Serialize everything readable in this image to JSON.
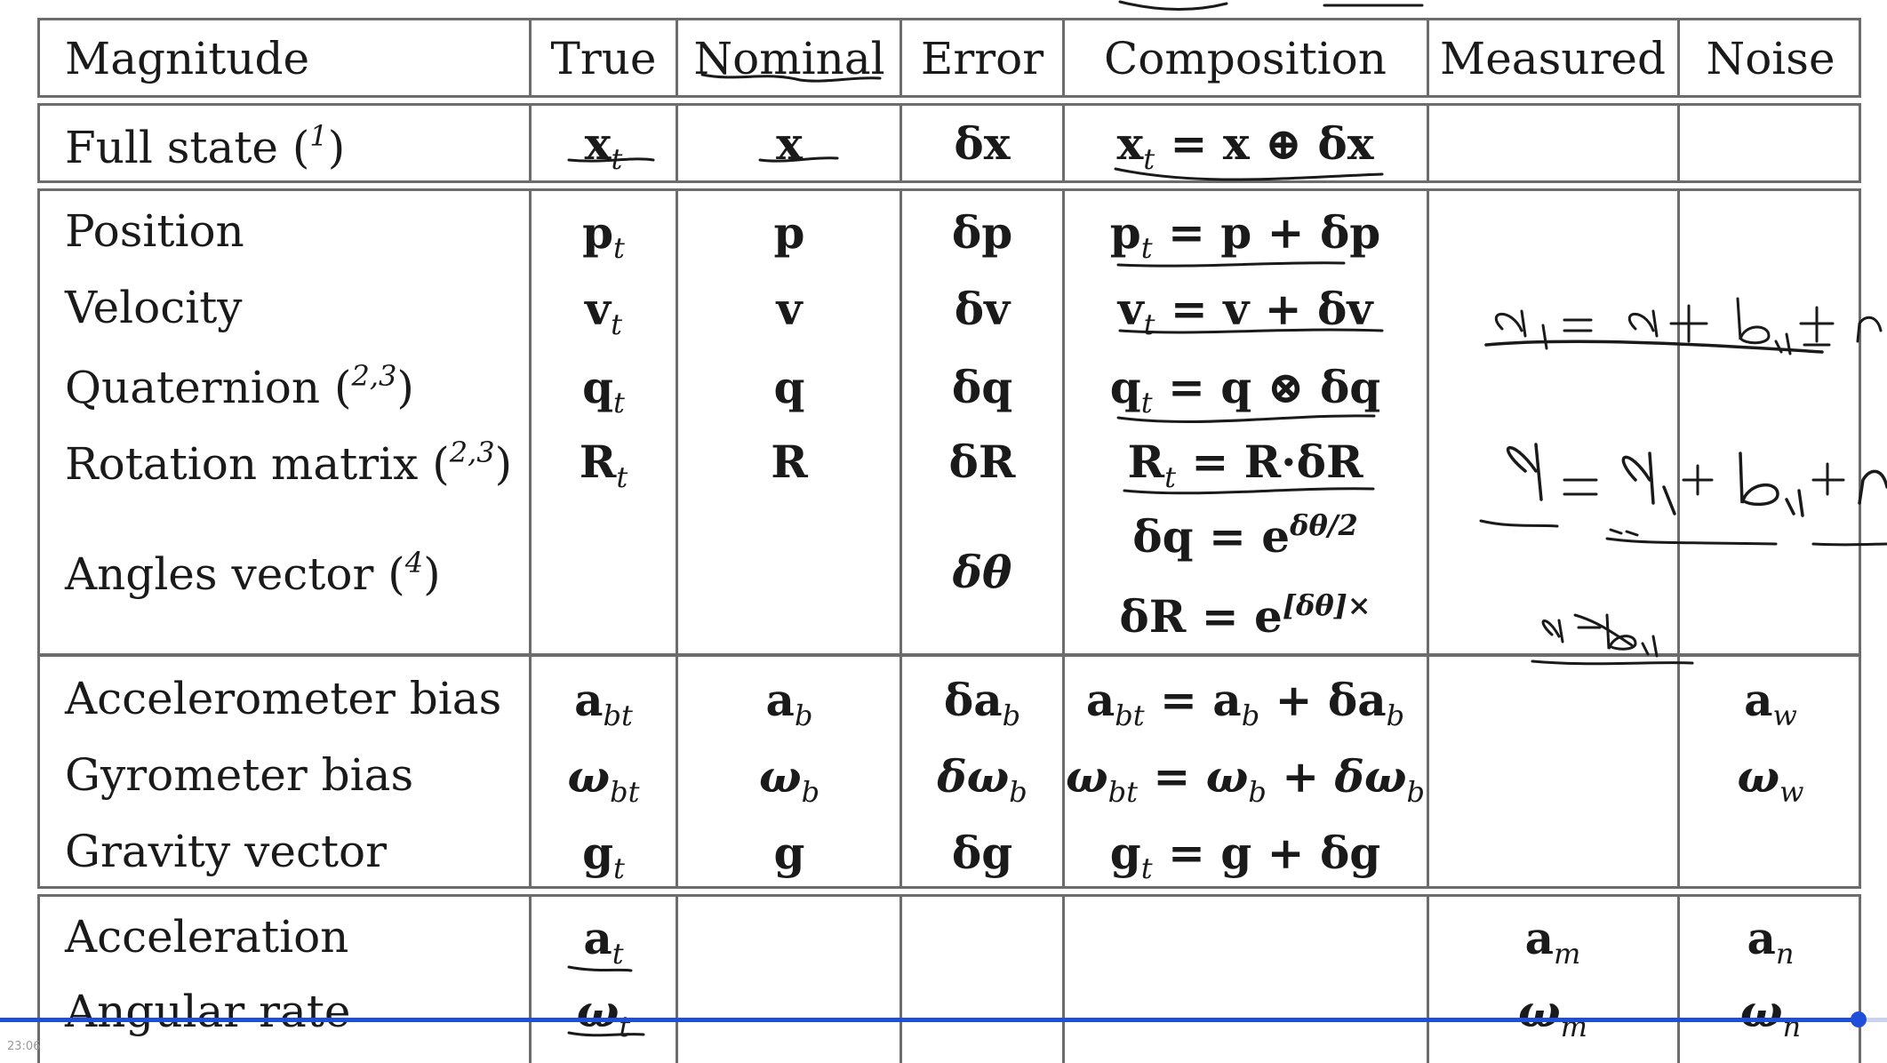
{
  "header": {
    "magnitude": "Magnitude",
    "true": "True",
    "nominal": "Nominal",
    "error": "Error",
    "composition": "Composition",
    "measured": "Measured",
    "noise": "Noise"
  },
  "rows": {
    "full_state": {
      "label": "Full state",
      "sup": "1",
      "true": "x",
      "true_sub": "t",
      "nominal": "x",
      "error": "δx",
      "composition": "x",
      "composition_sub": "t",
      "composition_rhs": " = x ⊕ δx"
    },
    "position": {
      "label": "Position",
      "true": "p",
      "true_sub": "t",
      "nominal": "p",
      "error": "δp",
      "composition": "p",
      "composition_sub": "t",
      "composition_rhs": " = p + δp"
    },
    "velocity": {
      "label": "Velocity",
      "true": "v",
      "true_sub": "t",
      "nominal": "v",
      "error": "δv",
      "composition": "v",
      "composition_sub": "t",
      "composition_rhs": " = v + δv"
    },
    "quaternion": {
      "label": "Quaternion",
      "sup": "2,3",
      "true": "q",
      "true_sub": "t",
      "nominal": "q",
      "error": "δq",
      "composition": "q",
      "composition_sub": "t",
      "composition_rhs": " = q ⊗ δq"
    },
    "rotation": {
      "label": "Rotation matrix",
      "sup": "2,3",
      "true": "R",
      "true_sub": "t",
      "nominal": "R",
      "error": "δR",
      "composition": "R",
      "composition_sub": "t",
      "composition_rhs": " = R·δR"
    },
    "angles": {
      "label": "Angles vector",
      "sup": "4",
      "error": "δθ",
      "composition_1": "δq = e",
      "composition_1_sup": "δθ/2",
      "composition_2": "δR = e",
      "composition_2_sup": "[δθ]×"
    },
    "acc_bias": {
      "label": "Accelerometer bias",
      "true": "a",
      "true_sub": "bt",
      "nominal": "a",
      "nominal_sub": "b",
      "error": "δa",
      "error_sub": "b",
      "composition": "a",
      "composition_sub": "bt",
      "composition_rhs": " = a",
      "composition_rhs_sub": "b",
      "composition_rhs2": " + δa",
      "composition_rhs2_sub": "b",
      "noise": "a",
      "noise_sub": "w"
    },
    "gyro_bias": {
      "label": "Gyrometer bias",
      "true": "ω",
      "true_sub": "bt",
      "nominal": "ω",
      "nominal_sub": "b",
      "error": "δω",
      "error_sub": "b",
      "composition": "ω",
      "composition_sub": "bt",
      "composition_rhs": " = ω",
      "composition_rhs_sub": "b",
      "composition_rhs2": " + δω",
      "composition_rhs2_sub": "b",
      "noise": "ω",
      "noise_sub": "w"
    },
    "gravity": {
      "label": "Gravity vector",
      "true": "g",
      "true_sub": "t",
      "nominal": "g",
      "error": "δg",
      "composition": "g",
      "composition_sub": "t",
      "composition_rhs": " = g + δg"
    },
    "acceleration": {
      "label": "Acceleration",
      "true": "a",
      "true_sub": "t",
      "measured": "a",
      "measured_sub": "m",
      "noise": "a",
      "noise_sub": "n"
    },
    "angular_rate": {
      "label": "Angular rate",
      "true": "ω",
      "true_sub": "t",
      "measured": "ω",
      "measured_sub": "m",
      "noise": "ω",
      "noise_sub": "n"
    }
  },
  "annotations": {
    "struck": "a_t = a + b_at ± n",
    "formula": "a = a_t + b_at + n",
    "struck_small": "a − b_at"
  },
  "player": {
    "progress": 0.985,
    "timestamp": "23:06"
  },
  "colors": {
    "ink": "#1a1a1a",
    "progress": "#1f4fd8",
    "border": "#6c6c6c"
  }
}
